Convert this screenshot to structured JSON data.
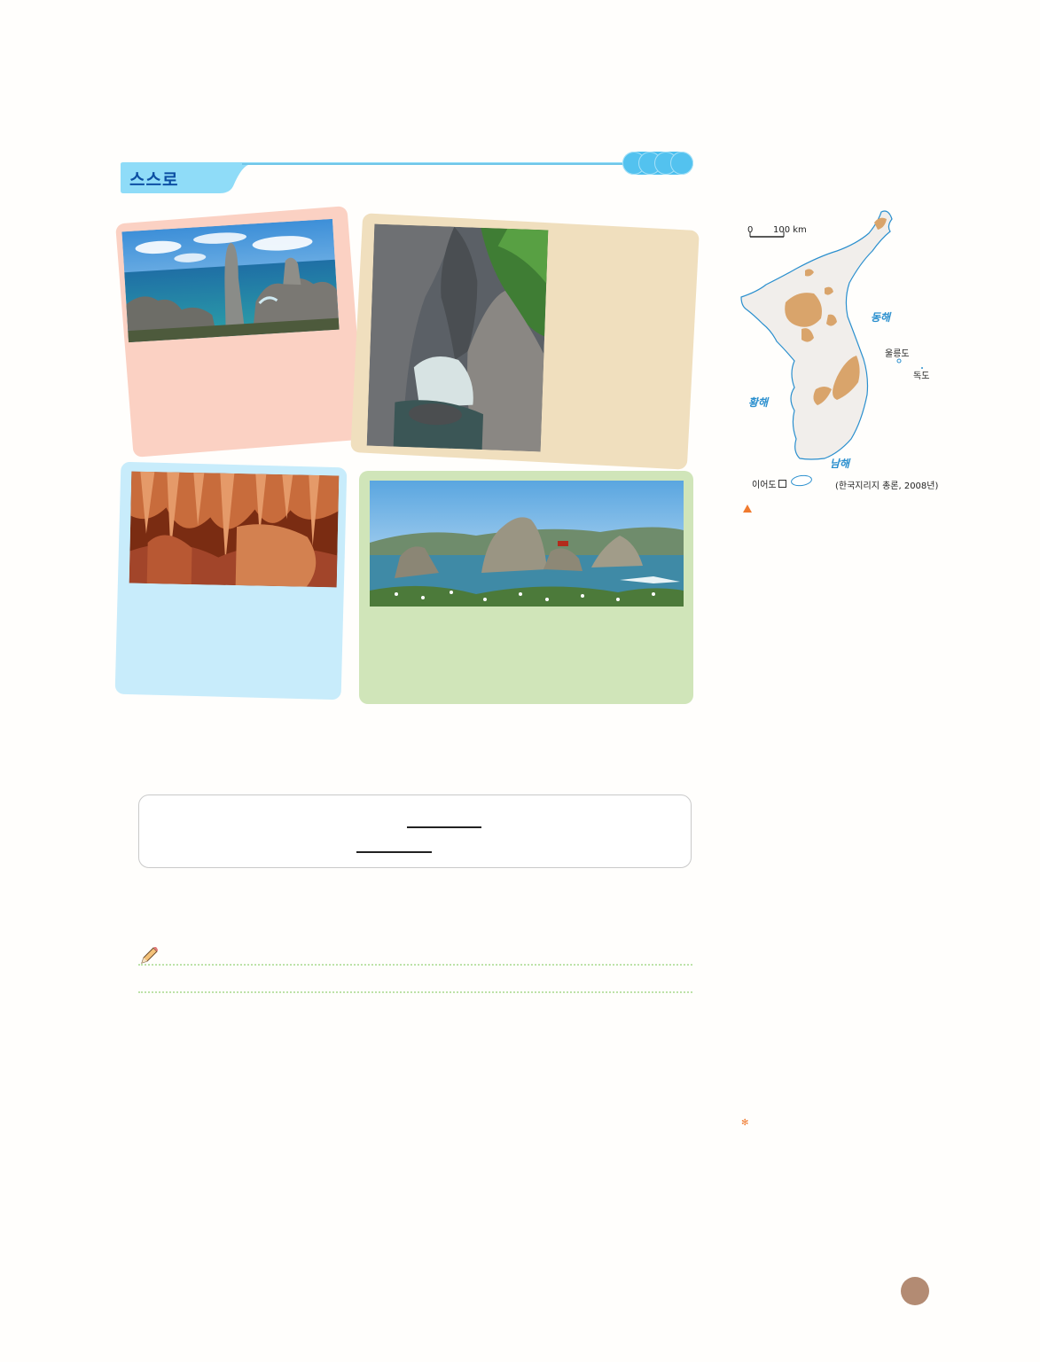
{
  "header": {
    "title": "스스로"
  },
  "map": {
    "scale_zero": "0",
    "scale_label": "100 km",
    "sea_east": "동해",
    "sea_west": "황해",
    "sea_south": "남해",
    "island_ulleung": "울릉도",
    "island_dokdo": "독도",
    "island_ieodo": "이어도",
    "source": "(한국지리지 총론, 2008년)",
    "colors": {
      "land": "#f1eeeb",
      "highland": "#d9a46b",
      "coast": "#2a8fce",
      "sea_label": "#2a8fce"
    }
  },
  "icons": [
    "pencil-icon",
    "triangle-marker-icon",
    "asterisk-icon"
  ],
  "colors": {
    "card_pink": "#fbd1c3",
    "card_tan": "#f0dfbe",
    "card_blue": "#c8ecfb",
    "card_green": "#d0e5b9",
    "accent_blue": "#4cbfee",
    "page_badge": "#b38b73"
  }
}
